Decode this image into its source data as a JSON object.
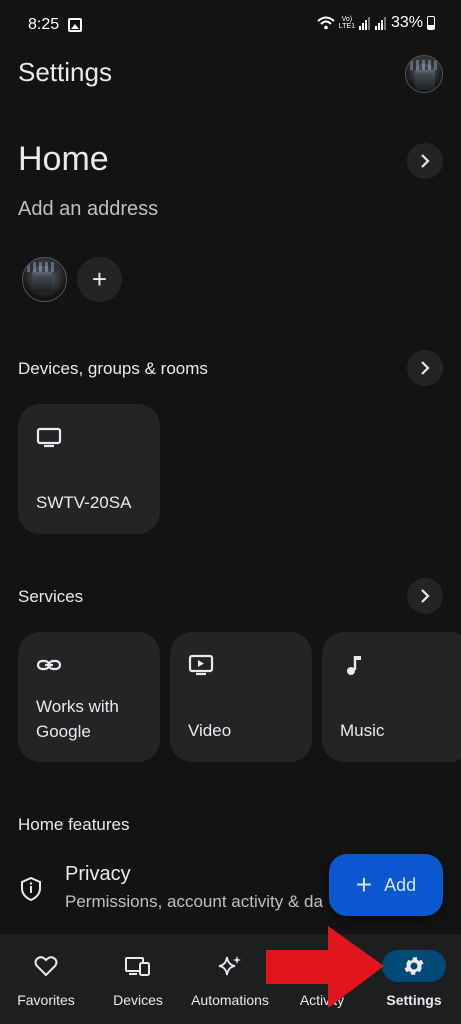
{
  "status_bar": {
    "time": "8:25",
    "network_top": "Vo)",
    "network_bottom": "LTE1",
    "battery": "33%"
  },
  "header": {
    "title": "Settings"
  },
  "home": {
    "title": "Home",
    "address_prompt": "Add an address",
    "add_member_label": "+"
  },
  "devices": {
    "section_title": "Devices, groups & rooms",
    "items": [
      {
        "label": "SWTV-20SA",
        "icon": "tv-icon"
      }
    ]
  },
  "services": {
    "section_title": "Services",
    "items": [
      {
        "label": "Works with Google",
        "icon": "link-icon"
      },
      {
        "label": "Video",
        "icon": "video-icon"
      },
      {
        "label": "Music",
        "icon": "music-note-icon"
      }
    ]
  },
  "home_features": {
    "section_title": "Home features",
    "privacy": {
      "title": "Privacy",
      "subtitle": "Permissions, account activity & da"
    }
  },
  "fab": {
    "label": "Add",
    "plus": "+"
  },
  "bottom_nav": {
    "items": [
      {
        "label": "Favorites",
        "icon": "heart-icon",
        "active": false
      },
      {
        "label": "Devices",
        "icon": "devices-icon",
        "active": false
      },
      {
        "label": "Automations",
        "icon": "sparkle-icon",
        "active": false
      },
      {
        "label": "Activity",
        "icon": "activity-icon",
        "active": false
      },
      {
        "label": "Settings",
        "icon": "gear-icon",
        "active": true
      }
    ]
  },
  "colors": {
    "background": "#131313",
    "card": "#232425",
    "accent": "#0b57d0",
    "nav_active": "#004a77",
    "annotation_arrow": "#e3151c"
  }
}
